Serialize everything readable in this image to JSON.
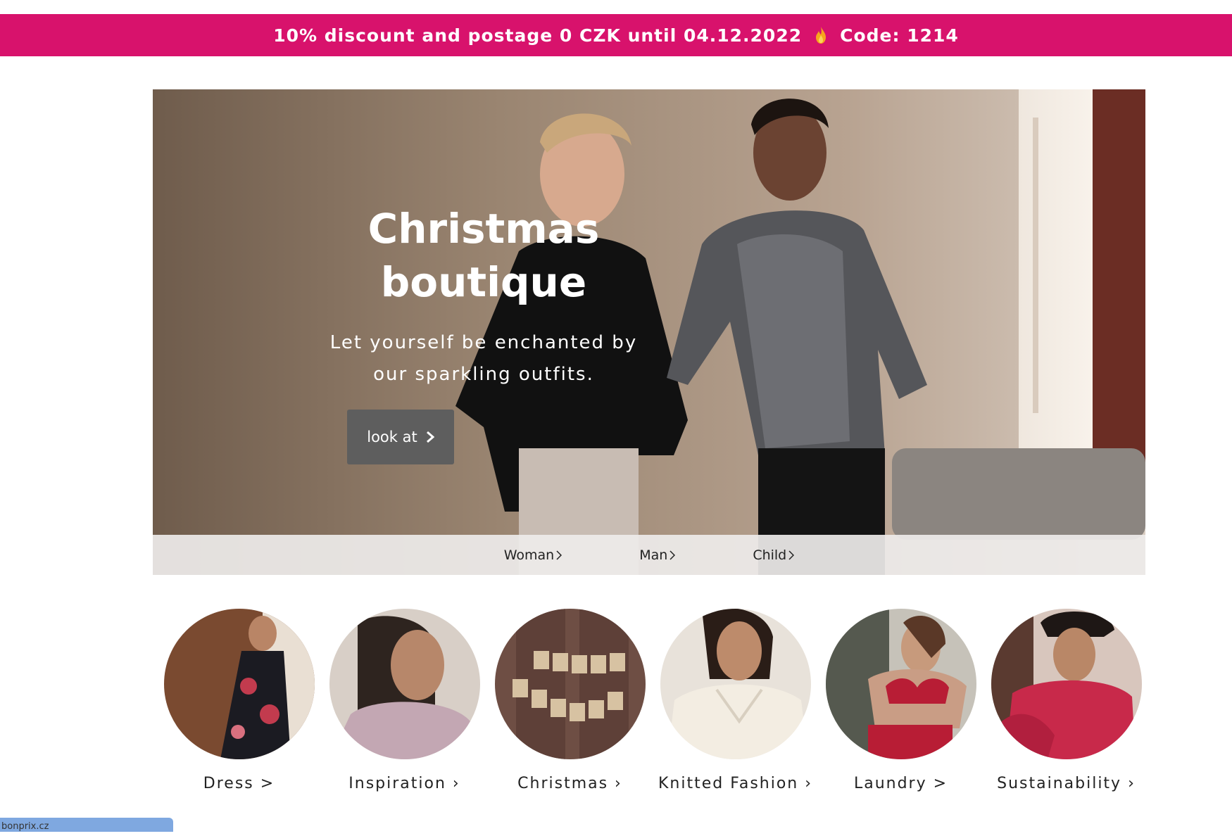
{
  "promo": {
    "text_before": "10% discount and postage 0 CZK until 04.12.2022",
    "text_after": "Code: 1214",
    "icon": "flame-icon",
    "color": "#d8126c"
  },
  "hero": {
    "title_line1": "Christmas",
    "title_line2": "boutique",
    "subtitle_line1": "Let yourself be enchanted by",
    "subtitle_line2": "our sparkling outfits.",
    "button_label": "look at",
    "nav": [
      {
        "label": "Woman"
      },
      {
        "label": "Man"
      },
      {
        "label": "Child"
      }
    ]
  },
  "categories": [
    {
      "label": "Dress >"
    },
    {
      "label": "Inspiration ›"
    },
    {
      "label": "Christmas ›"
    },
    {
      "label": "Knitted Fashion ›"
    },
    {
      "label": "Laundry >"
    },
    {
      "label": "Sustainability ›"
    }
  ],
  "status_bar": {
    "url": "bonprix.cz"
  }
}
